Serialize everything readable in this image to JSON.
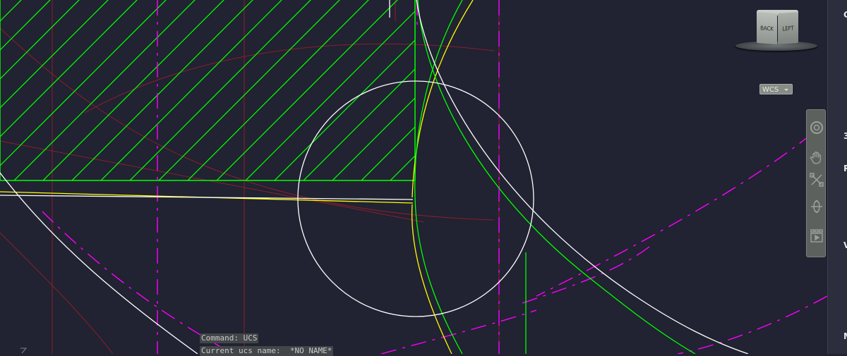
{
  "viewcube": {
    "back_label": "BACK",
    "left_label": "LEFT"
  },
  "coordinate_system_menu": {
    "label": "WCS"
  },
  "navigation_bar": {
    "tools": [
      "steering-wheel-icon",
      "pan-hand-icon",
      "zoom-extents-icon",
      "orbit-icon",
      "showmotion-icon"
    ]
  },
  "right_panel": {
    "labels": [
      "G",
      "3",
      "P",
      "V",
      "M"
    ]
  },
  "command_history": [
    "Command: UCS",
    "Current ucs name:  *NO NAME*"
  ],
  "colors": {
    "background": "#212232",
    "hatch": "#00ff00",
    "geometry_white": "#ffffff",
    "geometry_yellow": "#ffff00",
    "centerline_magenta": "#ff00ff",
    "construction_red": "#8b1f2a"
  }
}
